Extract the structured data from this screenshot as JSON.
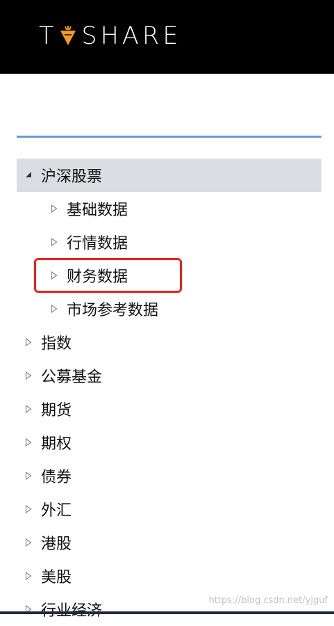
{
  "header": {
    "logo_left": "T",
    "logo_right": "SHARE",
    "logo_icon": "carrot-icon",
    "background": "#000000",
    "accent": "#f39c1f"
  },
  "nav": {
    "divider_color": "#6699dd",
    "items": [
      {
        "label": "沪深股票",
        "expanded": true,
        "active": true,
        "icon": "triangle-down-icon"
      },
      {
        "label": "基础数据",
        "icon": "triangle-right-icon"
      },
      {
        "label": "行情数据",
        "icon": "triangle-right-icon"
      },
      {
        "label": "财务数据",
        "icon": "triangle-right-icon",
        "highlighted": true
      },
      {
        "label": "市场参考数据",
        "icon": "triangle-right-icon"
      },
      {
        "label": "指数",
        "icon": "triangle-right-icon"
      },
      {
        "label": "公募基金",
        "icon": "triangle-right-icon"
      },
      {
        "label": "期货",
        "icon": "triangle-right-icon"
      },
      {
        "label": "期权",
        "icon": "triangle-right-icon"
      },
      {
        "label": "债券",
        "icon": "triangle-right-icon"
      },
      {
        "label": "外汇",
        "icon": "triangle-right-icon"
      },
      {
        "label": "港股",
        "icon": "triangle-right-icon"
      },
      {
        "label": "美股",
        "icon": "triangle-right-icon"
      },
      {
        "label": "行业经济",
        "icon": "triangle-right-icon"
      }
    ]
  },
  "highlight_color": "#e8231c",
  "watermark": "https://blog.csdn.net/yjguf"
}
